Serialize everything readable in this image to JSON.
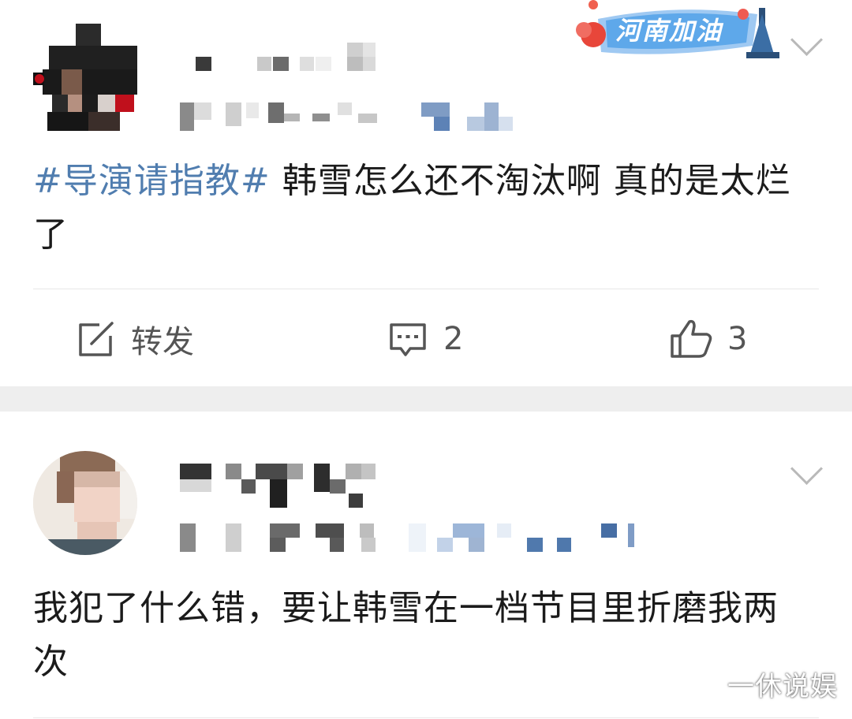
{
  "badge": {
    "text": "河南加油"
  },
  "posts": [
    {
      "topic": "#导演请指教#",
      "text": " 韩雪怎么还不淘汰啊 真的是太烂了",
      "actions": {
        "repost_label": "转发",
        "comment_count": "2",
        "like_count": "3"
      }
    },
    {
      "text": "我犯了什么错，要让韩雪在一档节目里折磨我两次"
    }
  ],
  "watermark": "一休说娱"
}
